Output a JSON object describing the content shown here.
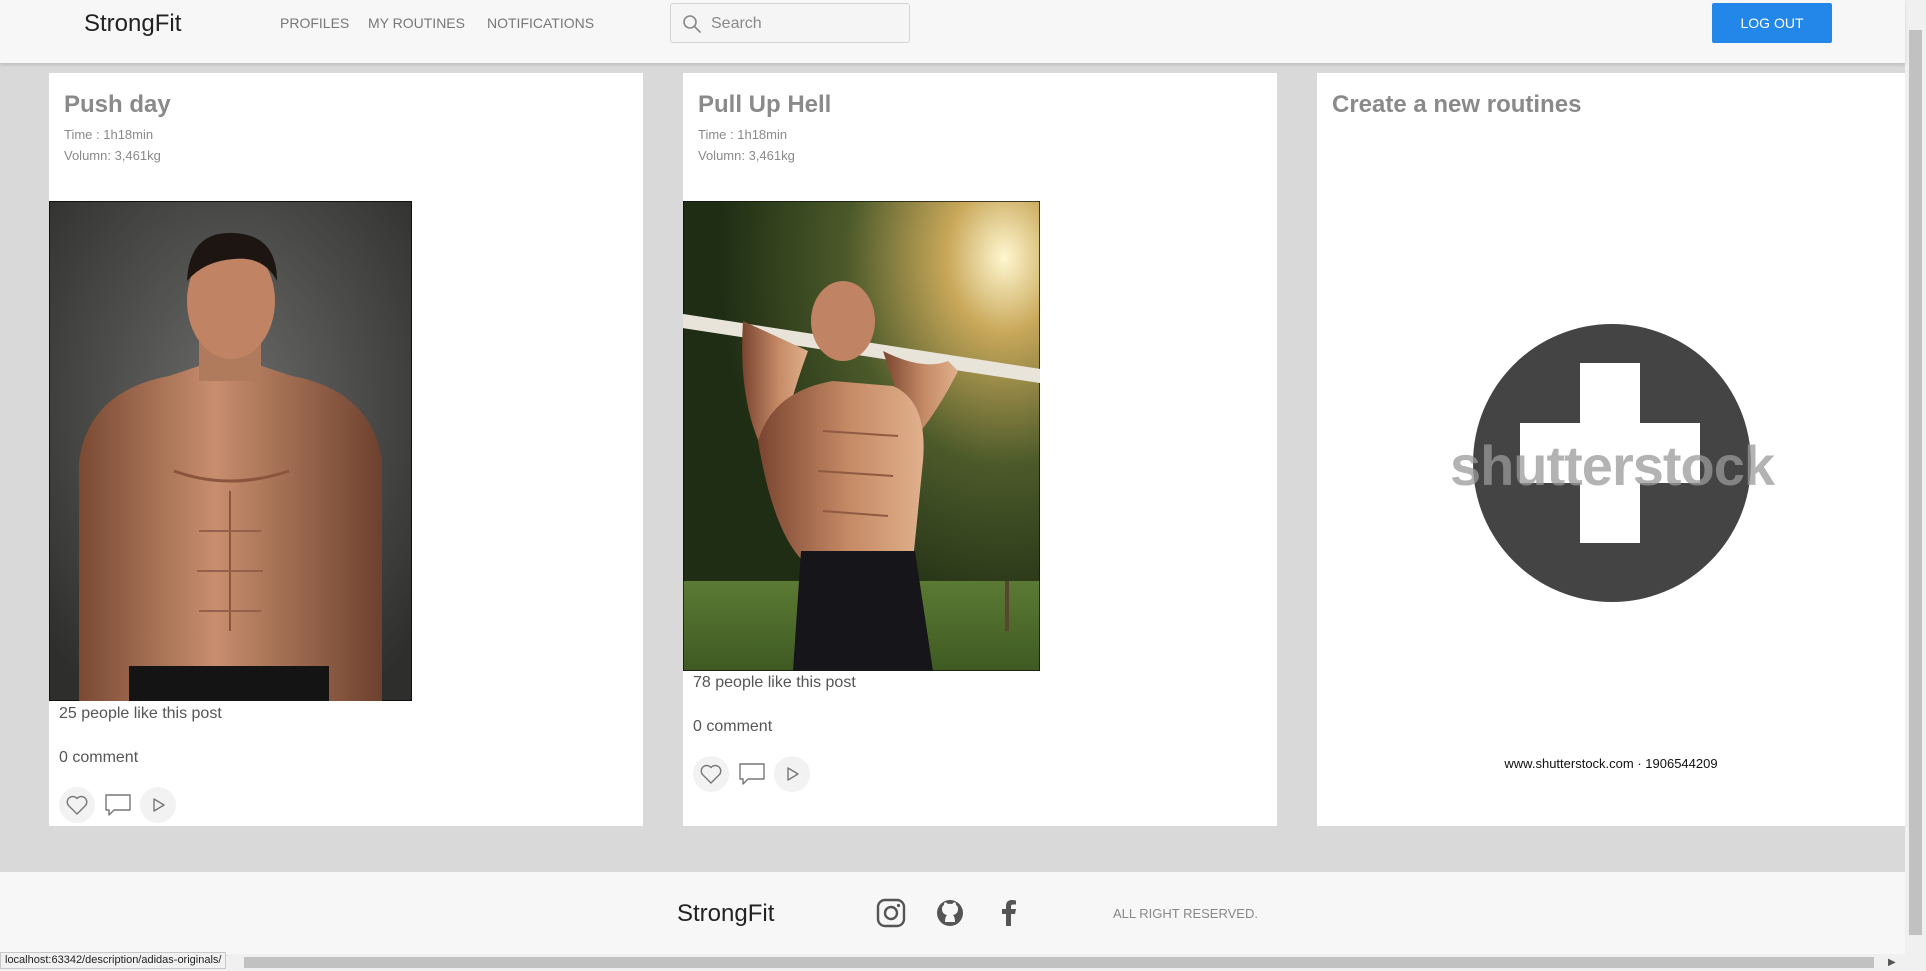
{
  "header": {
    "brand": "StrongFit",
    "nav": [
      "PROFILES",
      "MY ROUTINES",
      "NOTIFICATIONS"
    ],
    "search_placeholder": "Search",
    "logout_label": "LOG OUT"
  },
  "posts": [
    {
      "title": "Push day",
      "time": "Time : 1h18min",
      "volume": "Volumn: 3,461kg",
      "likes": "25 people like this post",
      "comments": "0 comment"
    },
    {
      "title": "Pull Up Hell",
      "time": "Time : 1h18min",
      "volume": "Volumn: 3,461kg",
      "likes": "78 people like this post",
      "comments": "0 comment"
    }
  ],
  "create": {
    "title": "Create a new routines",
    "watermark_text": "shutterstock",
    "watermark_url": "www.shutterstock.com · 1906544209"
  },
  "footer": {
    "brand": "StrongFit",
    "rights": "ALL RIGHT RESERVED."
  },
  "status_url": "localhost:63342/description/adidas-originals/",
  "colors": {
    "accent": "#2287e8",
    "background": "#d9d9d9",
    "card_title": "#8a8a8a",
    "plus_circle": "#444444"
  }
}
